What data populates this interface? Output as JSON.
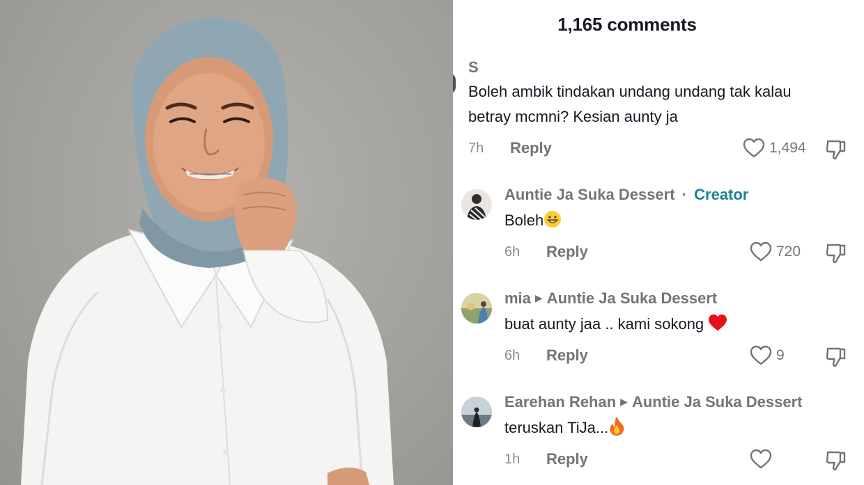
{
  "comments_panel": {
    "title": "1,165 comments",
    "comments": [
      {
        "author": "S",
        "text_lines": [
          "Boleh ambik tindakan undang undang tak kalau",
          "betray mcmni? Kesian aunty ja"
        ],
        "time": "7h",
        "reply_label": "Reply",
        "likes": "1,494"
      },
      {
        "author": "Auntie Ja Suka Dessert",
        "separator": "·",
        "badge": "Creator",
        "text": "Boleh",
        "emoji": "grinning-face",
        "time": "6h",
        "reply_label": "Reply",
        "likes": "720"
      },
      {
        "author": "mia",
        "reply_to": "Auntie Ja Suka Dessert",
        "text": "buat aunty jaa .. kami sokong",
        "emoji": "red-heart",
        "time": "6h",
        "reply_label": "Reply",
        "likes": "9"
      },
      {
        "author": "Earehan Rehan",
        "reply_to": "Auntie Ja Suka Dessert",
        "text": "teruskan TiJa...",
        "emoji": "fire",
        "time": "1h",
        "reply_label": "Reply",
        "likes": ""
      }
    ]
  },
  "icons": {
    "like": "heart-outline-icon",
    "dislike": "thumbs-down-icon",
    "reply_arrow": "triangle-right-icon"
  },
  "colors": {
    "creator_badge": "#1b8390",
    "muted_text": "#73747b",
    "primary_text": "#161823",
    "photo_background": "#a4a29e"
  }
}
